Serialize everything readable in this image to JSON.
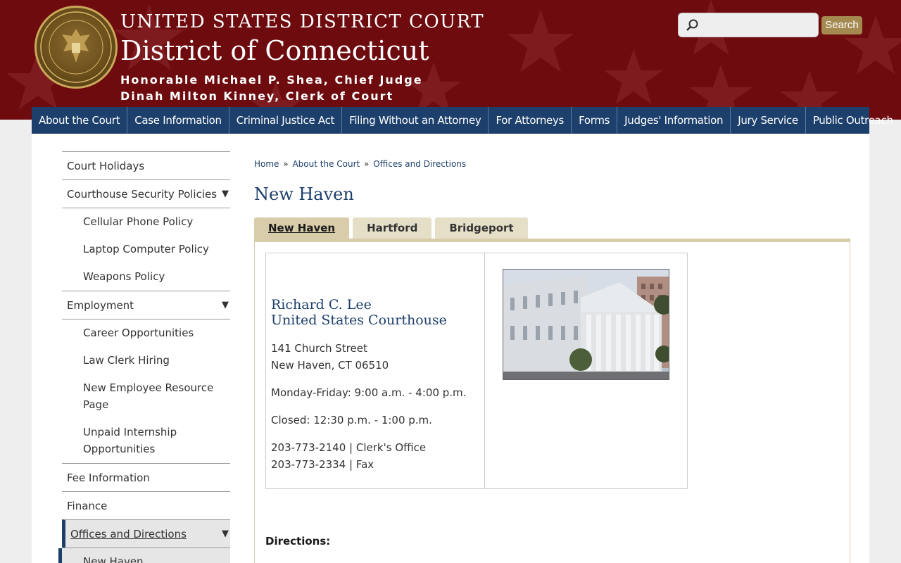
{
  "header": {
    "title_small": "UNITED STATES DISTRICT COURT",
    "title_big": "District of Connecticut",
    "chief_judge": "Honorable Michael P. Shea, Chief Judge",
    "clerk": "Dinah Milton Kinney, Clerk of Court",
    "search_placeholder": "",
    "search_button": "Search"
  },
  "nav": {
    "items": [
      "About the Court",
      "Case Information",
      "Criminal Justice Act",
      "Filing Without an Attorney",
      "For Attorneys",
      "Forms",
      "Judges' Information",
      "Jury Service",
      "Public Outreach"
    ]
  },
  "sidebar": {
    "court_holidays": "Court Holidays",
    "security_policies": "Courthouse Security Policies",
    "cellular": "Cellular Phone Policy",
    "laptop": "Laptop Computer Policy",
    "weapons": "Weapons Policy",
    "employment": "Employment",
    "career": "Career Opportunities",
    "law_clerk": "Law Clerk Hiring",
    "new_employee": "New Employee Resource Page",
    "internship": "Unpaid Internship Opportunities",
    "fee_info": "Fee Information",
    "finance": "Finance",
    "offices": "Offices and Directions",
    "new_haven": "New Haven",
    "expand_arrow": "▼"
  },
  "breadcrumb": {
    "home": "Home",
    "about": "About the Court",
    "current": "Offices and Directions",
    "sep": "»"
  },
  "page_title": "New Haven",
  "tabs": [
    "New Haven",
    "Hartford",
    "Bridgeport"
  ],
  "courthouse": {
    "name_line1": "Richard C. Lee",
    "name_line2": "United States Courthouse",
    "street": "141 Church Street",
    "city": "New Haven, CT 06510",
    "hours": "Monday-Friday: 9:00 a.m. - 4:00 p.m.",
    "closed": "Closed: 12:30 p.m. - 1:00 p.m.",
    "phone1": "203-773-2140 | Clerk's Office",
    "phone2": "203-773-2334 | Fax"
  },
  "directions_label": "Directions:",
  "colors": {
    "header_bg": "#6e0b0f",
    "nav_bg": "#1d3f6b",
    "tab_active": "#d8ccaa",
    "tab_inactive": "#e6dfc8",
    "search_button": "#a48a51"
  }
}
